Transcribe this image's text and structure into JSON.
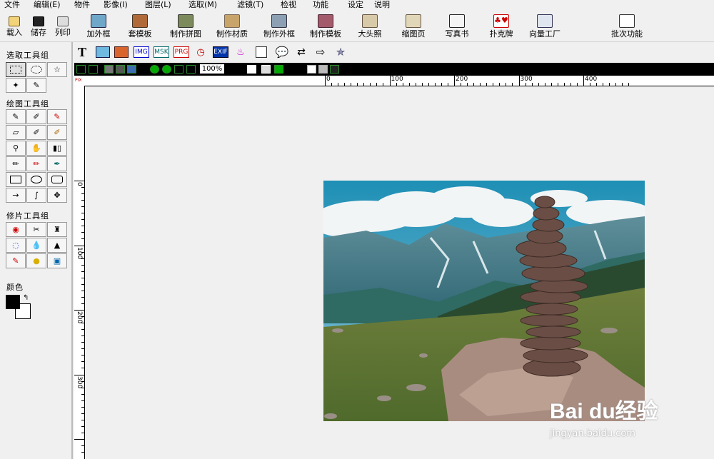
{
  "menu": [
    "文件",
    "编辑(E)",
    "物件",
    "影像(I)",
    "图层(L)",
    "选取(M)",
    "滤镜(T)",
    "检视",
    "功能",
    "设定",
    "说明"
  ],
  "toolbar": {
    "load": "载入",
    "save": "储存",
    "print": "列印",
    "add_frame": "加外框",
    "apply_template": "套模板",
    "make_collage": "制作拼图",
    "make_material": "制作材质",
    "make_frame": "制作外框",
    "make_template": "制作模板",
    "big_head": "大头照",
    "thumbnail_page": "缩图页",
    "photo_book": "写真书",
    "poker": "扑克牌",
    "vector_factory": "向量工厂",
    "batch": "批次功能"
  },
  "left_panel": {
    "selection_group": "选取工具组",
    "drawing_group": "绘图工具组",
    "retouch_group": "修片工具组",
    "color_label": "颜色",
    "fg_color": "#000000",
    "bg_color": "#ffffff"
  },
  "toolbar2": {
    "text_tool": "T",
    "img_label": "IMG",
    "msk_label": "MSK",
    "prg_label": "PRG",
    "exif_label": "EXIF"
  },
  "blackbar": {
    "zoom": "100%"
  },
  "ruler": {
    "corner_label": "PIX",
    "h_labels": [
      "0",
      "100",
      "200",
      "300",
      "400"
    ],
    "v_labels": [
      "0",
      "100",
      "200",
      "300"
    ]
  },
  "watermark": {
    "logo": "Bai du经验",
    "url": "jingyan.baidu.com"
  },
  "icons": [
    "undo-icon",
    "redo-icon",
    "copy-icon",
    "cut-icon",
    "paste-icon",
    "zoom-in-icon",
    "zoom-out-icon",
    "fit-icon",
    "actual-size-icon",
    "pointer-icon",
    "hand-icon",
    "add-icon"
  ],
  "colors": {
    "accent_green": "#2a8a2a",
    "black_bar": "#000000"
  }
}
